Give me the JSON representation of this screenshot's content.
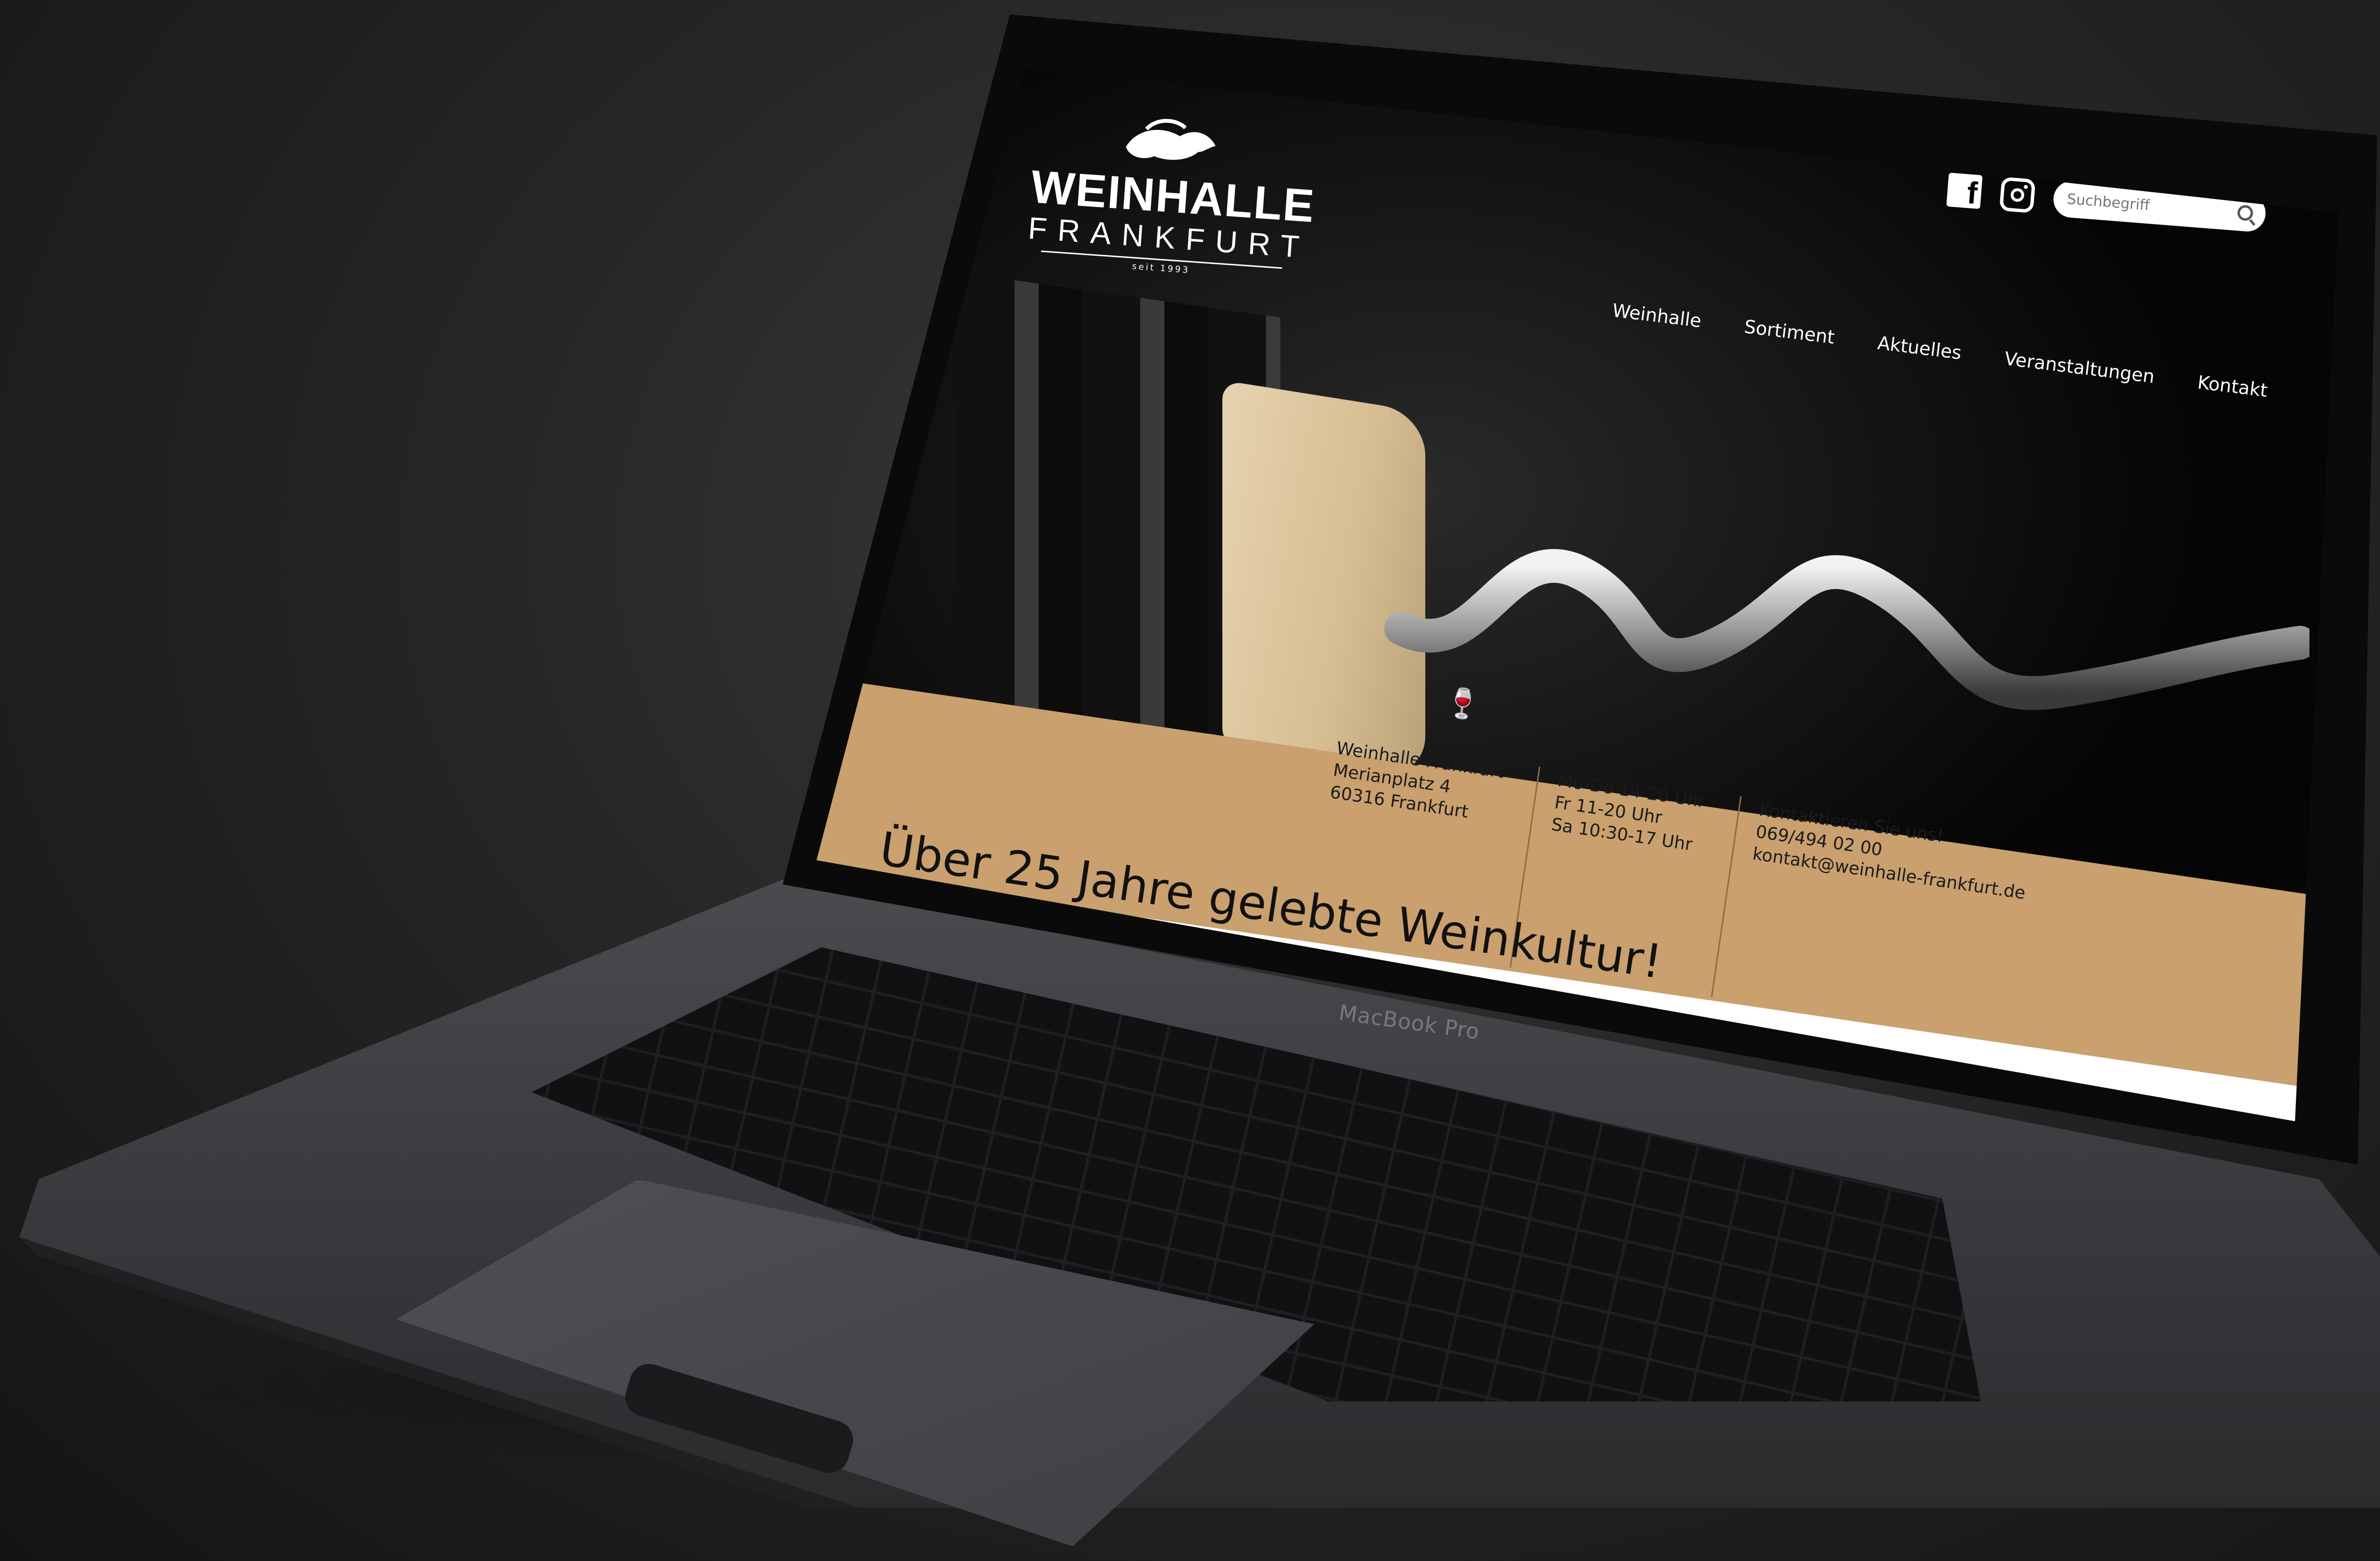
{
  "site": {
    "logo": {
      "name": "WEINHALLE",
      "city": "FRANKFURT",
      "since": "seit 1993"
    },
    "search": {
      "placeholder": "Suchbegriff"
    },
    "social": {
      "facebook_icon": "facebook-icon",
      "instagram_icon": "instagram-icon"
    },
    "nav": [
      "Weinhalle",
      "Sortiment",
      "Aktuelles",
      "Veranstaltungen",
      "Kontakt"
    ],
    "info": {
      "address": [
        "Weinhalle Frankfurt",
        "Merianplatz 4",
        "60316 Frankfurt"
      ],
      "hours": [
        "Mo-Do 14-20 Uhr",
        "Fr 11-20 Uhr",
        "Sa 10:30-17 Uhr"
      ],
      "contact": [
        "Kontaktieren Sie uns!",
        "069/494 02 00",
        "kontakt@weinhalle-frankfurt.de"
      ]
    },
    "tagline": "Über 25 Jahre gelebte Weinkultur!",
    "colors": {
      "accent": "#c9a06e",
      "background": "#000000",
      "text_dark": "#1b1b1b"
    }
  },
  "device": {
    "label": "MacBook Pro"
  }
}
